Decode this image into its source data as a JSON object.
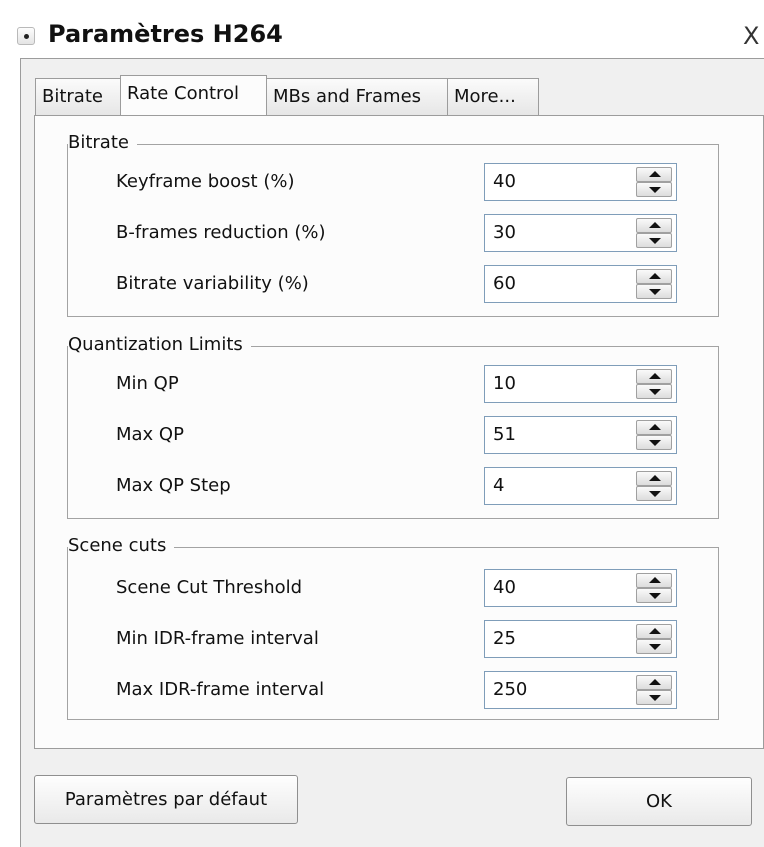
{
  "window": {
    "title": "Paramètres H264",
    "close_label": "X"
  },
  "tabs": [
    "Bitrate",
    "Rate Control",
    "MBs and Frames",
    "More..."
  ],
  "active_tab": "Rate Control",
  "groups": [
    {
      "title": "Bitrate",
      "rows": [
        {
          "label": "Keyframe boost (%)",
          "value": "40"
        },
        {
          "label": "B-frames reduction (%)",
          "value": "30"
        },
        {
          "label": "Bitrate variability (%)",
          "value": "60"
        }
      ]
    },
    {
      "title": "Quantization Limits",
      "rows": [
        {
          "label": "Min QP",
          "value": "10"
        },
        {
          "label": "Max QP",
          "value": "51"
        },
        {
          "label": "Max QP Step",
          "value": "4"
        }
      ]
    },
    {
      "title": "Scene cuts",
      "rows": [
        {
          "label": "Scene Cut Threshold",
          "value": "40"
        },
        {
          "label": "Min IDR-frame interval",
          "value": "25"
        },
        {
          "label": "Max IDR-frame interval",
          "value": "250"
        }
      ]
    }
  ],
  "buttons": {
    "defaults_label": "Paramètres par défaut",
    "ok_label": "OK"
  },
  "icons": {
    "system_menu": "system-menu-icon",
    "spin_up": "arrow-up-icon",
    "spin_down": "arrow-down-icon"
  }
}
